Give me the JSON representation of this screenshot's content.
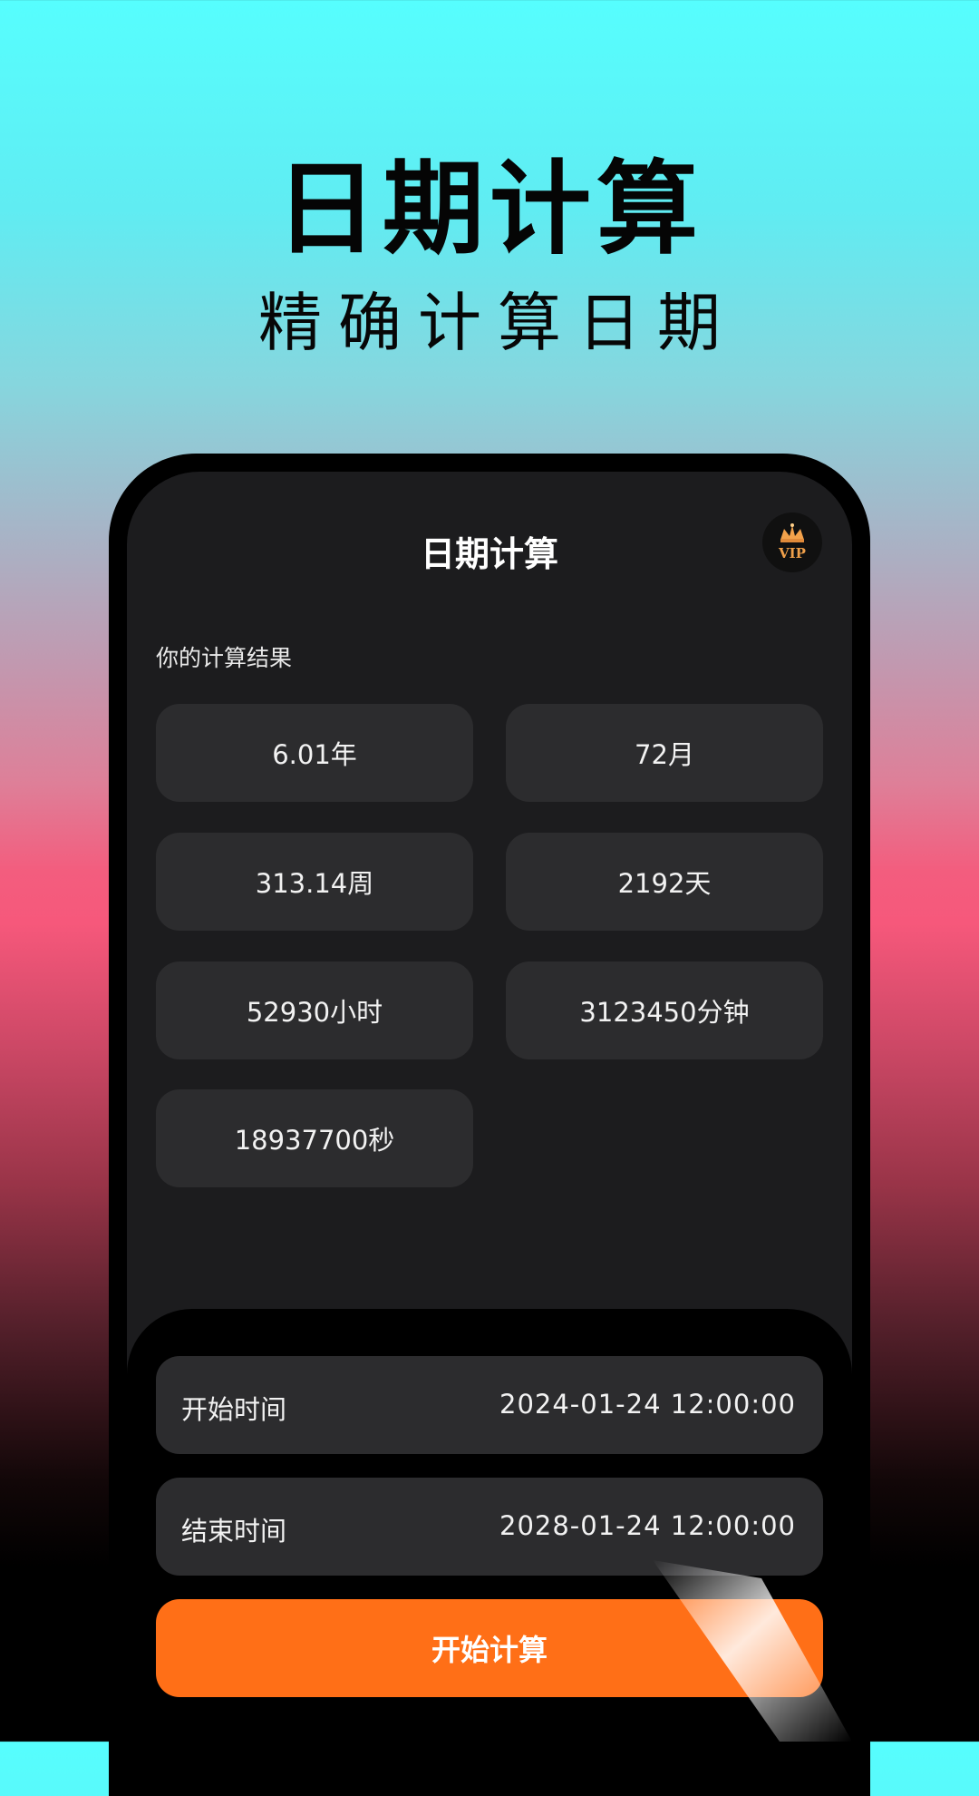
{
  "hero": {
    "title": "日期计算",
    "subtitle": "精确计算日期"
  },
  "app": {
    "title": "日期计算",
    "vip_label": "VIP",
    "results_label": "你的计算结果",
    "results": [
      "6.01年",
      "72月",
      "313.14周",
      "2192天",
      "52930小时",
      "3123450分钟",
      "18937700秒"
    ],
    "start": {
      "label": "开始时间",
      "value": "2024-01-24 12:00:00"
    },
    "end": {
      "label": "结束时间",
      "value": "2028-01-24 12:00:00"
    },
    "button_label": "开始计算"
  },
  "colors": {
    "accent": "#ff6f17",
    "card": "#2c2c2e",
    "screen": "#1c1c1e"
  }
}
